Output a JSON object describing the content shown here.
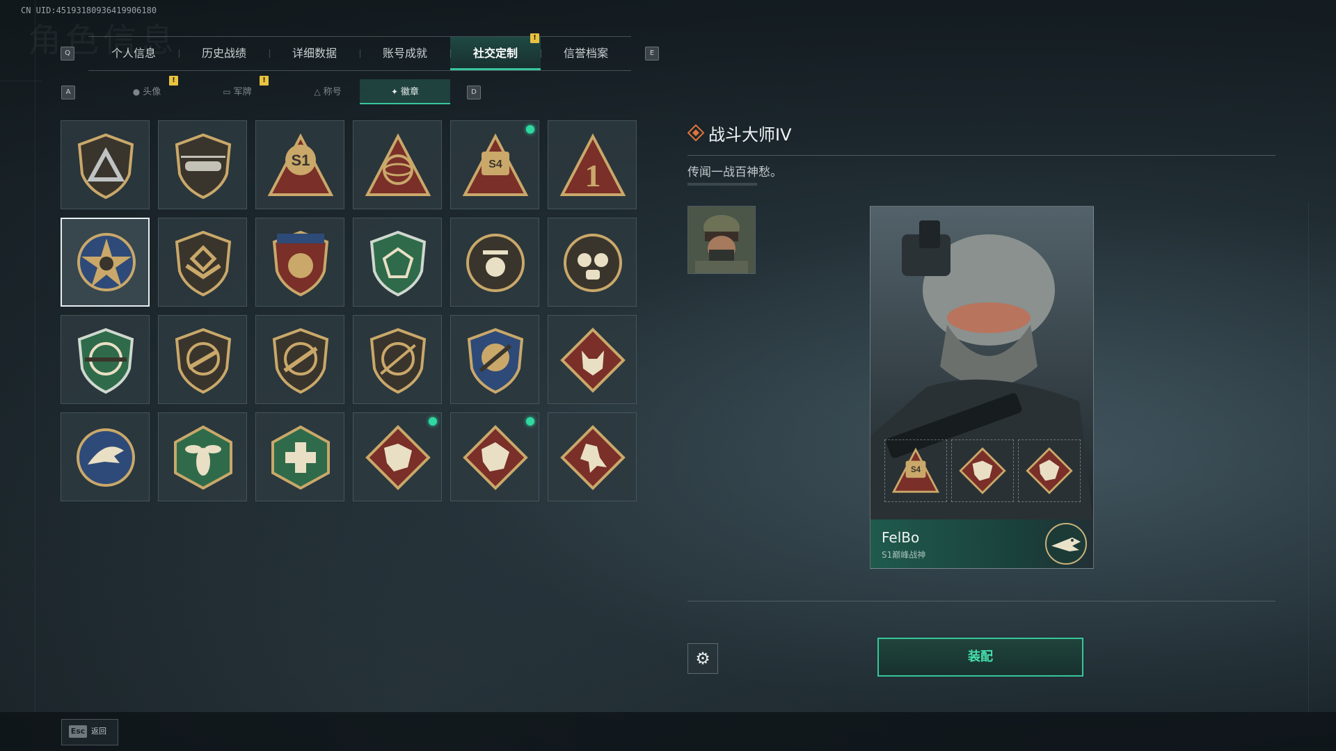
{
  "uid": "CN UID:45193180936419906180",
  "background_title": "角色信息",
  "tabs": {
    "left_key": "Q",
    "right_key": "E",
    "items": [
      {
        "label": "个人信息"
      },
      {
        "label": "历史战绩"
      },
      {
        "label": "详细数据"
      },
      {
        "label": "账号成就"
      },
      {
        "label": "社交定制",
        "active": true,
        "alert": "!"
      },
      {
        "label": "信誉档案"
      }
    ]
  },
  "subtabs": {
    "left_key": "A",
    "right_key": "D",
    "items": [
      {
        "label": "头像",
        "icon": "person-icon",
        "alert": "!"
      },
      {
        "label": "军牌",
        "icon": "dogtag-icon",
        "alert": "!"
      },
      {
        "label": "称号",
        "icon": "triangle-icon"
      },
      {
        "label": "徽章",
        "icon": "badge-icon",
        "active": true
      }
    ]
  },
  "badges": [
    {
      "name": "shield-delta",
      "new": false
    },
    {
      "name": "helicopter",
      "new": false
    },
    {
      "name": "s1-balloon",
      "new": false
    },
    {
      "name": "gyroscope",
      "new": false
    },
    {
      "name": "s4-trophy",
      "new": true
    },
    {
      "name": "number-one",
      "new": false
    },
    {
      "name": "star-skull",
      "new": false,
      "selected": true
    },
    {
      "name": "chevron-shield",
      "new": false
    },
    {
      "name": "star-crest",
      "new": false
    },
    {
      "name": "green-gem",
      "new": false
    },
    {
      "name": "skull-hat",
      "new": false
    },
    {
      "name": "gas-mask",
      "new": false
    },
    {
      "name": "green-rifle",
      "new": false
    },
    {
      "name": "smg-shield",
      "new": false
    },
    {
      "name": "rifle-shield",
      "new": false
    },
    {
      "name": "sniper-shield",
      "new": false
    },
    {
      "name": "blue-crest",
      "new": false
    },
    {
      "name": "wolf",
      "new": false
    },
    {
      "name": "eagle",
      "new": false
    },
    {
      "name": "hornet",
      "new": false
    },
    {
      "name": "medic",
      "new": false
    },
    {
      "name": "dragon-1",
      "new": true
    },
    {
      "name": "dragon-2",
      "new": true
    },
    {
      "name": "runner",
      "new": false
    }
  ],
  "detail": {
    "title": "战斗大师IV",
    "description": "传闻一战百神愁。"
  },
  "player_card": {
    "name": "FelBo",
    "subtitle": "S1巅峰战神"
  },
  "buttons": {
    "equip": "装配",
    "settings_icon": "gear-icon",
    "esc_key": "Esc",
    "back": "返回"
  },
  "colors": {
    "accent": "#38c59b",
    "alert": "#e8c241",
    "new_dot": "#2fd9a0"
  }
}
